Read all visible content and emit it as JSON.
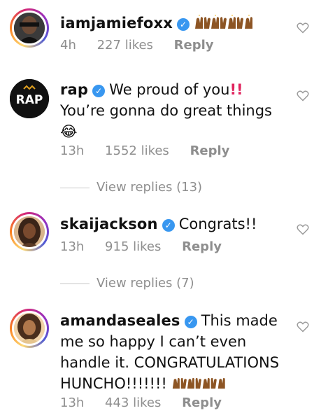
{
  "comments": [
    {
      "username": "iamjamiefoxx",
      "text": "",
      "time": "4h",
      "likes": "227 likes",
      "reply": "Reply"
    },
    {
      "username": "rap",
      "text_line1": "We proud of you",
      "text_line1_suffix": "!!",
      "text_line2": "You’re gonna do great things",
      "emoji": "😂",
      "time": "13h",
      "likes": "1552 likes",
      "reply": "Reply",
      "view_replies": "View replies (13)"
    },
    {
      "username": "skaijackson",
      "text": "Congrats!!",
      "time": "13h",
      "likes": "915 likes",
      "reply": "Reply",
      "view_replies": "View replies (7)"
    },
    {
      "username": "amandaseales",
      "text_line1": "This made",
      "text_line2": "me so happy I can’t even",
      "text_line3": "handle it. CONGRATULATIONS",
      "text_line4": "HUNCHO!!!!!!!",
      "time": "13h",
      "likes": "443 likes",
      "reply": "Reply"
    }
  ],
  "colors": {
    "verified": "#3897f0",
    "meta": "#8e8e8e",
    "skin": "#8d5524"
  },
  "icons": {
    "verified": "verified-badge-icon",
    "like": "heart-outline-icon",
    "hands": "raised-hands-icon"
  }
}
